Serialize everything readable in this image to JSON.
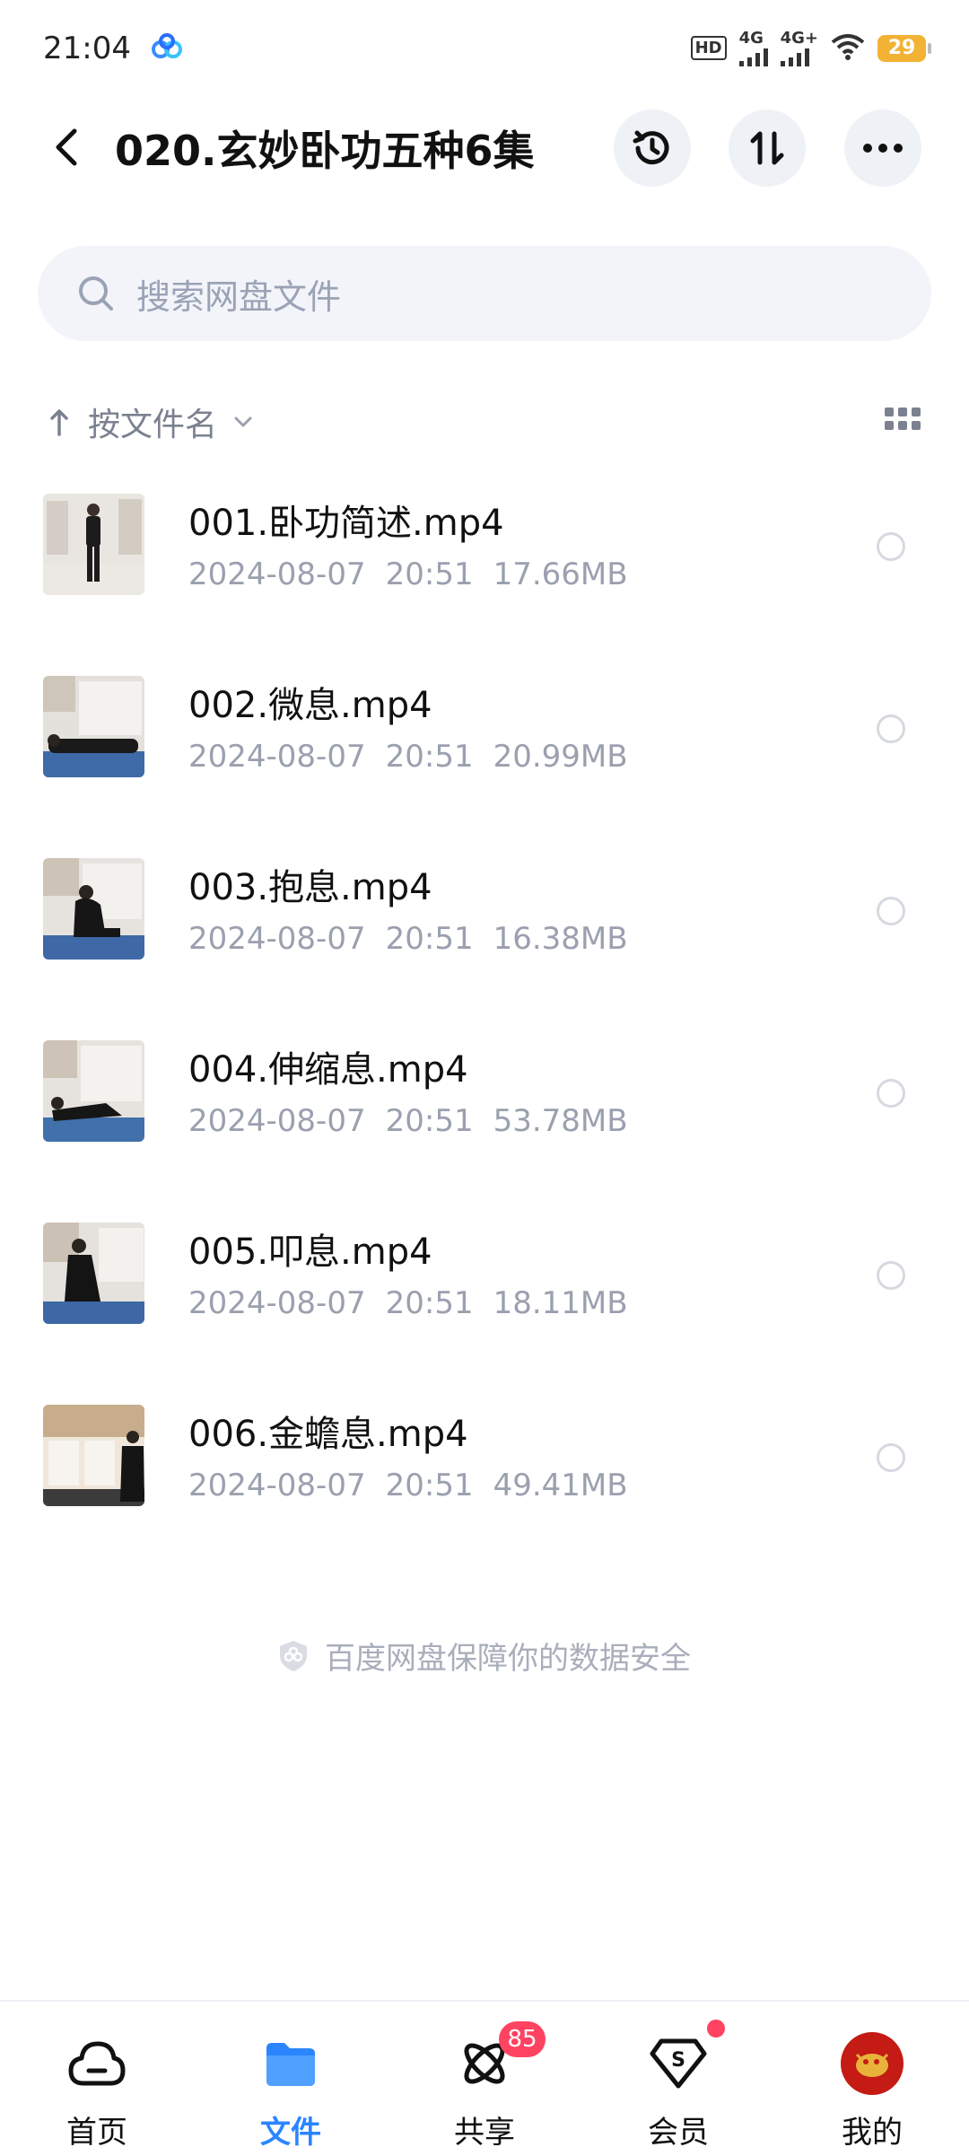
{
  "status_bar": {
    "time": "21:04",
    "hd_label": "HD",
    "net1": "4G",
    "net2": "4G+",
    "battery": "29"
  },
  "header": {
    "title": "020.玄妙卧功五种6集"
  },
  "search": {
    "placeholder": "搜索网盘文件"
  },
  "sort": {
    "label": "按文件名"
  },
  "files": [
    {
      "name": "001.卧功简述.mp4",
      "date": "2024-08-07",
      "time": "20:51",
      "size": "17.66MB"
    },
    {
      "name": "002.微息.mp4",
      "date": "2024-08-07",
      "time": "20:51",
      "size": "20.99MB"
    },
    {
      "name": "003.抱息.mp4",
      "date": "2024-08-07",
      "time": "20:51",
      "size": "16.38MB"
    },
    {
      "name": "004.伸缩息.mp4",
      "date": "2024-08-07",
      "time": "20:51",
      "size": "53.78MB"
    },
    {
      "name": "005.叩息.mp4",
      "date": "2024-08-07",
      "time": "20:51",
      "size": "18.11MB"
    },
    {
      "name": "006.金蟾息.mp4",
      "date": "2024-08-07",
      "time": "20:51",
      "size": "49.41MB"
    }
  ],
  "footer_note": "百度网盘保障你的数据安全",
  "tabs": [
    {
      "label": "首页",
      "icon": "cloud-home-icon"
    },
    {
      "label": "文件",
      "icon": "folder-icon",
      "active": true
    },
    {
      "label": "共享",
      "icon": "share-orbit-icon",
      "badge": "85"
    },
    {
      "label": "会员",
      "icon": "vip-diamond-icon"
    },
    {
      "label": "我的",
      "icon": "avatar"
    }
  ],
  "colors": {
    "accent": "#2a85ff",
    "badge": "#ff4361",
    "battery": "#f2b233"
  }
}
